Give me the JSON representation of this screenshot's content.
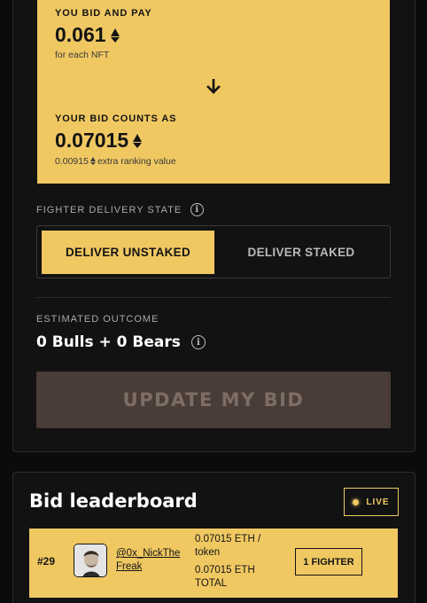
{
  "bid": {
    "pay_label": "YOU BID AND PAY",
    "pay_value": "0.061",
    "pay_sub": "for each NFT",
    "counts_label": "YOUR BID COUNTS AS",
    "counts_value": "0.07015",
    "extra_value": "0.00915",
    "extra_label": "extra ranking value"
  },
  "delivery": {
    "label": "FIGHTER DELIVERY STATE",
    "options": [
      "DELIVER UNSTAKED",
      "DELIVER STAKED"
    ],
    "selected": "DELIVER UNSTAKED"
  },
  "outcome": {
    "label": "ESTIMATED OUTCOME",
    "value": "0 Bulls + 0 Bears"
  },
  "update_button": "UPDATE MY BID",
  "leaderboard": {
    "title": "Bid leaderboard",
    "live_label": "LIVE",
    "rows": [
      {
        "rank": "#29",
        "handle": "@0x_NickTheFreak",
        "per_token": "0.07015 ETH / token",
        "total": "0.07015 ETH TOTAL",
        "fighters": "1 FIGHTER"
      }
    ]
  },
  "colors": {
    "accent": "#f0c862",
    "background": "#0b0b0c",
    "panel": "#121213",
    "disabled_button": "#4a3c36"
  },
  "icons": [
    "eth-icon",
    "arrow-down-icon",
    "info-icon",
    "live-dot-icon"
  ]
}
